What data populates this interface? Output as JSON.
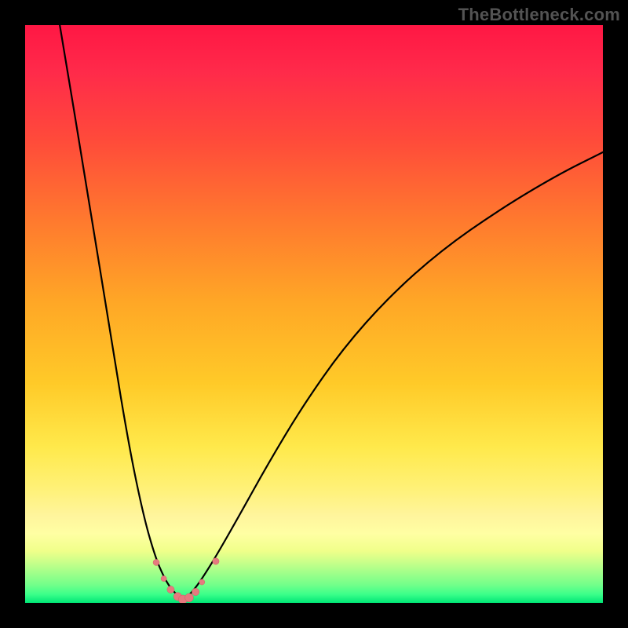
{
  "watermark": "TheBottleneck.com",
  "colors": {
    "page_bg": "#000000",
    "dot_fill": "#e67a7f",
    "dot_stroke": "#d06066",
    "curve_stroke": "#000000",
    "gradient_stops": [
      {
        "offset": 0.0,
        "color": "#ff1744"
      },
      {
        "offset": 0.08,
        "color": "#ff2a4a"
      },
      {
        "offset": 0.2,
        "color": "#ff4b3a"
      },
      {
        "offset": 0.34,
        "color": "#ff7a2e"
      },
      {
        "offset": 0.48,
        "color": "#ffa726"
      },
      {
        "offset": 0.62,
        "color": "#ffca28"
      },
      {
        "offset": 0.73,
        "color": "#ffe94b"
      },
      {
        "offset": 0.8,
        "color": "#fff176"
      },
      {
        "offset": 0.85,
        "color": "#fff59d"
      },
      {
        "offset": 0.88,
        "color": "#ffffa3"
      },
      {
        "offset": 0.91,
        "color": "#f0ff8a"
      },
      {
        "offset": 0.93,
        "color": "#c8ff8a"
      },
      {
        "offset": 0.95,
        "color": "#9cff8a"
      },
      {
        "offset": 0.97,
        "color": "#6fff8a"
      },
      {
        "offset": 0.985,
        "color": "#3cff8a"
      },
      {
        "offset": 1.0,
        "color": "#00e676"
      }
    ]
  },
  "chart_data": {
    "type": "line",
    "title": "",
    "xlabel": "",
    "ylabel": "",
    "xlim": [
      0,
      100
    ],
    "ylim": [
      0,
      100
    ],
    "series": [
      {
        "name": "curve-left",
        "x": [
          6,
          11,
          15,
          18,
          20.5,
          22.5,
          24.0,
          25.2,
          26.2,
          26.8,
          27.2
        ],
        "values": [
          100,
          70,
          45,
          27,
          15,
          8.0,
          4.5,
          2.5,
          1.5,
          0.8,
          0.5
        ]
      },
      {
        "name": "curve-right",
        "x": [
          27.2,
          28.0,
          29.0,
          30.5,
          33.0,
          37,
          42,
          48,
          55,
          63,
          72,
          82,
          92,
          100
        ],
        "values": [
          0.5,
          1.0,
          2.0,
          4.0,
          8.0,
          15,
          24,
          34,
          44,
          53,
          61,
          68,
          74,
          78
        ]
      }
    ],
    "minimum_x": 27,
    "dots": [
      {
        "x": 22.7,
        "y": 7.0,
        "r": 4.0
      },
      {
        "x": 24.0,
        "y": 4.2,
        "r": 3.6
      },
      {
        "x": 25.2,
        "y": 2.3,
        "r": 4.6
      },
      {
        "x": 26.4,
        "y": 1.1,
        "r": 5.2
      },
      {
        "x": 27.3,
        "y": 0.6,
        "r": 5.6
      },
      {
        "x": 28.4,
        "y": 0.9,
        "r": 5.4
      },
      {
        "x": 29.5,
        "y": 1.9,
        "r": 4.7
      },
      {
        "x": 30.6,
        "y": 3.6,
        "r": 3.6
      },
      {
        "x": 33.0,
        "y": 7.2,
        "r": 4.2
      }
    ]
  }
}
